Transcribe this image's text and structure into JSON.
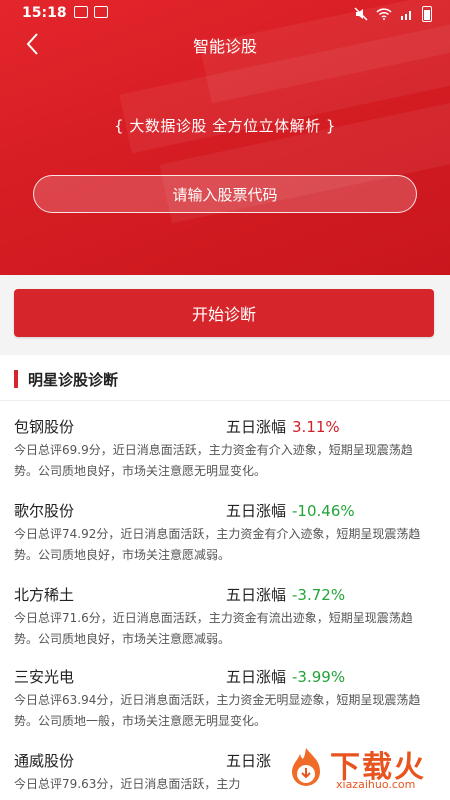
{
  "status_bar": {
    "time": "15:18"
  },
  "nav": {
    "title": "智能诊股"
  },
  "hero": {
    "tagline": "{ 大数据诊股 全方位立体解析 }",
    "search_placeholder": "请输入股票代码"
  },
  "actions": {
    "start_label": "开始诊断"
  },
  "section": {
    "title": "明星诊股诊断"
  },
  "stocks": [
    {
      "name": "包钢股份",
      "change_label": "五日涨幅",
      "change": "3.11%",
      "desc": "今日总评69.9分，近日消息面活跃，主力资金有介入迹象，短期呈现震荡趋势。公司质地良好，市场关注意愿无明显变化。"
    },
    {
      "name": "歌尔股份",
      "change_label": "五日涨幅",
      "change": "-10.46%",
      "desc": "今日总评74.92分，近日消息面活跃，主力资金有介入迹象，短期呈现震荡趋势。公司质地良好，市场关注意愿减弱。"
    },
    {
      "name": "北方稀土",
      "change_label": "五日涨幅",
      "change": "-3.72%",
      "desc": "今日总评71.6分，近日消息面活跃，主力资金有流出迹象，短期呈现震荡趋势。公司质地良好，市场关注意愿减弱。"
    },
    {
      "name": "三安光电",
      "change_label": "五日涨幅",
      "change": "-3.99%",
      "desc": "今日总评63.94分，近日消息面活跃，主力资金无明显迹象，短期呈现震荡趋势。公司质地一般，市场关注意愿无明显变化。"
    },
    {
      "name": "通威股份",
      "change_label": "五日涨",
      "change": "",
      "desc": "今日总评79.63分，近日消息面活跃，主力"
    }
  ],
  "watermark": {
    "text": "下载火",
    "url": "xiazaihuo.com"
  },
  "colors": {
    "brand_red": "#d7262b",
    "up": "#d1202a",
    "down": "#22a43a"
  }
}
